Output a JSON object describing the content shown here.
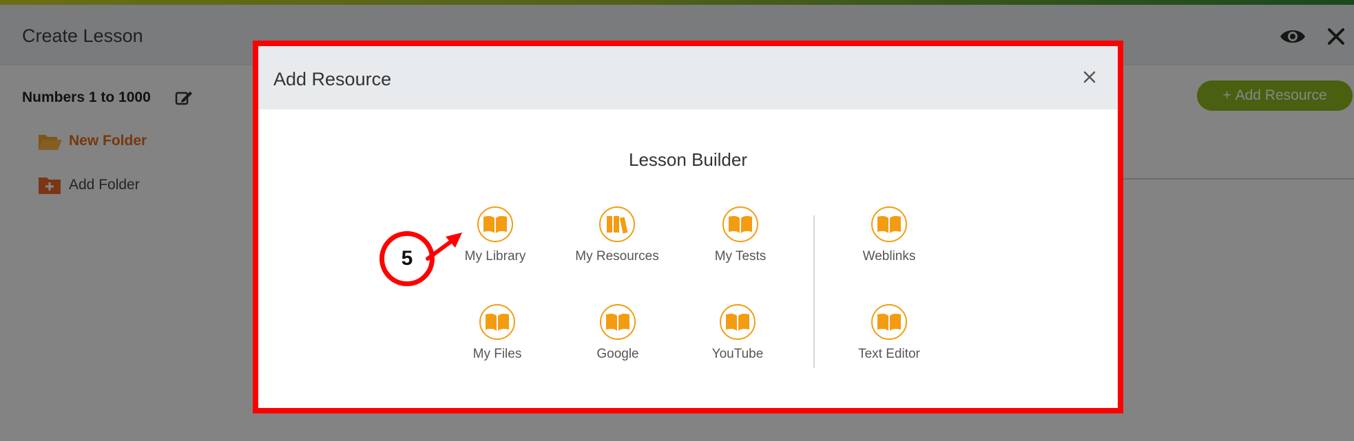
{
  "app": {
    "title": "Create Lesson"
  },
  "header": {
    "icons": [
      "eye-icon",
      "close-icon"
    ]
  },
  "sidebar": {
    "lesson_title": "Numbers 1 to 1000",
    "edit_icon": "edit-icon",
    "new_folder": "New Folder",
    "add_folder": "Add Folder"
  },
  "toolbar": {
    "add_resource_label": "Add Resource"
  },
  "modal": {
    "title": "Add Resource",
    "section_title": "Lesson Builder",
    "items": [
      {
        "label": "My Library",
        "icon": "book-icon"
      },
      {
        "label": "My Resources",
        "icon": "books-icon"
      },
      {
        "label": "My Tests",
        "icon": "book-icon"
      },
      {
        "label": "Weblinks",
        "icon": "book-icon"
      },
      {
        "label": "My Files",
        "icon": "book-icon"
      },
      {
        "label": "Google",
        "icon": "book-icon"
      },
      {
        "label": "YouTube",
        "icon": "book-icon"
      },
      {
        "label": "Text Editor",
        "icon": "book-icon"
      }
    ]
  },
  "annotation": {
    "step": "5"
  },
  "colors": {
    "accent_orange": "#f39c12",
    "folder_orange": "#e06a18",
    "brand_green": "#8cb41f",
    "highlight_red": "#ff0000"
  }
}
